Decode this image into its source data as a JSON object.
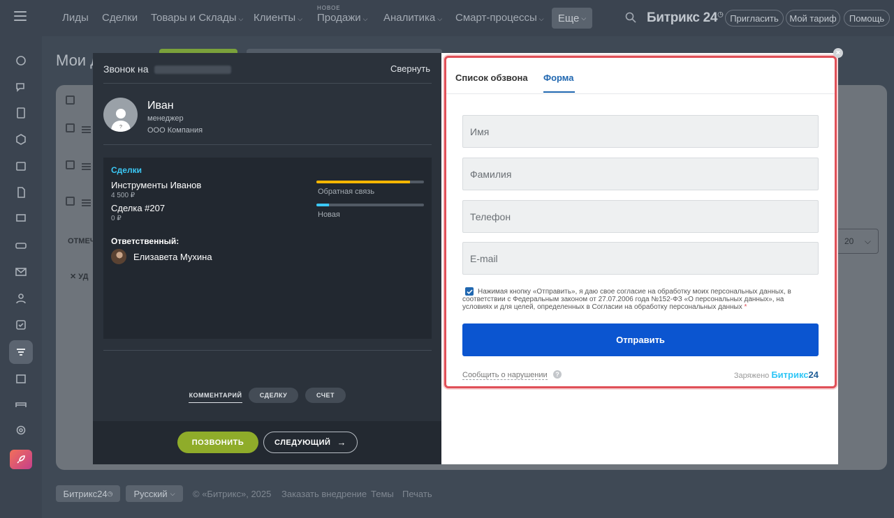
{
  "topbar": {
    "nav": [
      "Лиды",
      "Сделки",
      "Товары и Склады",
      "Клиенты",
      "Продажи",
      "Аналитика",
      "Смарт-процессы"
    ],
    "nav_new_badge": "НОВОЕ",
    "more_label": "Еще",
    "brand_name": "Битрикс 24",
    "invite_label": "Пригласить",
    "tariff_label": "Мой тариф",
    "help_label": "Помощь"
  },
  "background": {
    "page_title": "Мои д",
    "mark_label": "ОТМЕЧ",
    "delete_label": "УД",
    "page_size": "20"
  },
  "footer": {
    "brand_label": "Битрикс24",
    "language_label": "Русский",
    "copyright": "© «Битрикс», 2025",
    "order_link": "Заказать внедрение",
    "themes_link": "Темы",
    "print_link": "Печать"
  },
  "call": {
    "header_label": "Звонок на",
    "collapse_label": "Свернуть",
    "contact": {
      "name": "Иван",
      "role": "менеджер",
      "company": "ООО Компания"
    },
    "deals_title": "Сделки",
    "deals": [
      {
        "name": "Инструменты Иванов",
        "sum": "4 500 ₽",
        "stage": "Обратная связь",
        "progress": 0.87,
        "color": "#f7b600"
      },
      {
        "name": "Сделка #207",
        "sum": "0 ₽",
        "stage": "Новая",
        "progress": 0.12,
        "color": "#3bc8f5"
      }
    ],
    "responsible_title": "Ответственный:",
    "responsible_name": "Елизавета Мухина",
    "tabs": [
      "КОММЕНТАРИЙ",
      "СДЕЛКУ",
      "СЧЕТ"
    ],
    "call_button": "ПОЗВОНИТЬ",
    "next_button": "СЛЕДУЮЩИЙ"
  },
  "form": {
    "tabs": [
      "Список обзвона",
      "Форма"
    ],
    "active_tab": "Форма",
    "fields": [
      {
        "placeholder": "Имя",
        "value": ""
      },
      {
        "placeholder": "Фамилия",
        "value": ""
      },
      {
        "placeholder": "Телефон",
        "value": ""
      },
      {
        "placeholder": "E-mail",
        "value": ""
      }
    ],
    "consent_text": "Нажимая кнопку «Отправить», я даю свое согласие на обработку моих персональных данных, в соответствии с Федеральным законом от 27.07.2006 года №152-ФЗ «О персональных данных», на условиях и для целей, определенных в Согласии на обработку персональных данных",
    "consent_required_mark": "*",
    "submit_label": "Отправить",
    "report_link": "Сообщить о нарушении",
    "powered_by": "Заряжено",
    "powered_brand_a": "Битрикс",
    "powered_brand_b": "24"
  },
  "colors": {
    "accent_blue": "#0b55d0",
    "highlight_red": "#e05058",
    "call_green": "#8fac2a",
    "deals_cyan": "#3bc8f5"
  }
}
